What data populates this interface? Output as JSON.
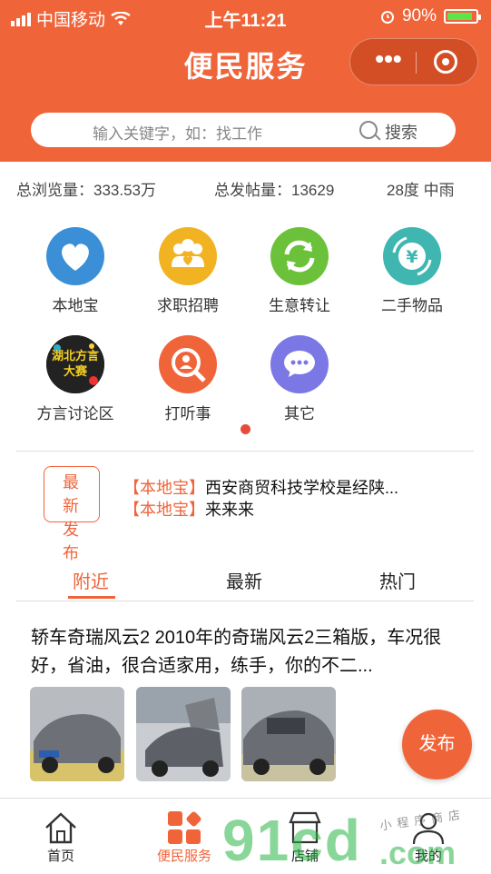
{
  "status_bar": {
    "carrier": "中国移动",
    "time": "上午11:21",
    "battery": "90%",
    "battery_level": 0.9
  },
  "header": {
    "title": "便民服务"
  },
  "search": {
    "placeholder": "输入关键字，如：找工作",
    "button": "搜索"
  },
  "stats": {
    "views": "总浏览量：333.53万",
    "posts": "总发帖量：13629",
    "weather": "28度 中雨"
  },
  "categories": [
    {
      "label": "本地宝",
      "icon": "heart-icon",
      "color": "#3a8fd6"
    },
    {
      "label": "求职招聘",
      "icon": "people-icon",
      "color": "#f2b322"
    },
    {
      "label": "生意转让",
      "icon": "refresh-icon",
      "color": "#6cc13a"
    },
    {
      "label": "二手物品",
      "icon": "yuan-icon",
      "color": "#3fb6b0"
    },
    {
      "label": "方言讨论区",
      "icon": "dialect-avatar-icon",
      "color": "#2a2a2a",
      "image_text": "湖北方言大赛"
    },
    {
      "label": "打听事",
      "icon": "inquiry-icon",
      "color": "#f0643a"
    },
    {
      "label": "其它",
      "icon": "more-icon",
      "color": "#7b78e6"
    }
  ],
  "latest": {
    "badge": "最新发布",
    "badge_line1": "最 新",
    "badge_line2": "发 布",
    "items": [
      {
        "tag": "【本地宝】",
        "text": "西安商贸科技学校是经陕..."
      },
      {
        "tag": "【本地宝】",
        "text": "来来来"
      }
    ]
  },
  "tabs": [
    {
      "label": "附近",
      "active": true
    },
    {
      "label": "最新",
      "active": false
    },
    {
      "label": "热门",
      "active": false
    }
  ],
  "post": {
    "text": "轿车奇瑞风云2 2010年的奇瑞风云2三箱版，车况很好，省油，很合适家用，练手，你的不二..."
  },
  "fab": {
    "label": "发布"
  },
  "tabbar": [
    {
      "label": "首页",
      "icon": "home-icon"
    },
    {
      "label": "便民服务",
      "icon": "grid-icon"
    },
    {
      "label": "店铺",
      "icon": "shop-icon"
    },
    {
      "label": "我的",
      "icon": "user-icon"
    }
  ],
  "watermark": {
    "main": "91cd",
    "suffix": ".com",
    "small": "小程序商店"
  },
  "colors": {
    "accent": "#f0643a",
    "active_tab": "#f0643a"
  }
}
